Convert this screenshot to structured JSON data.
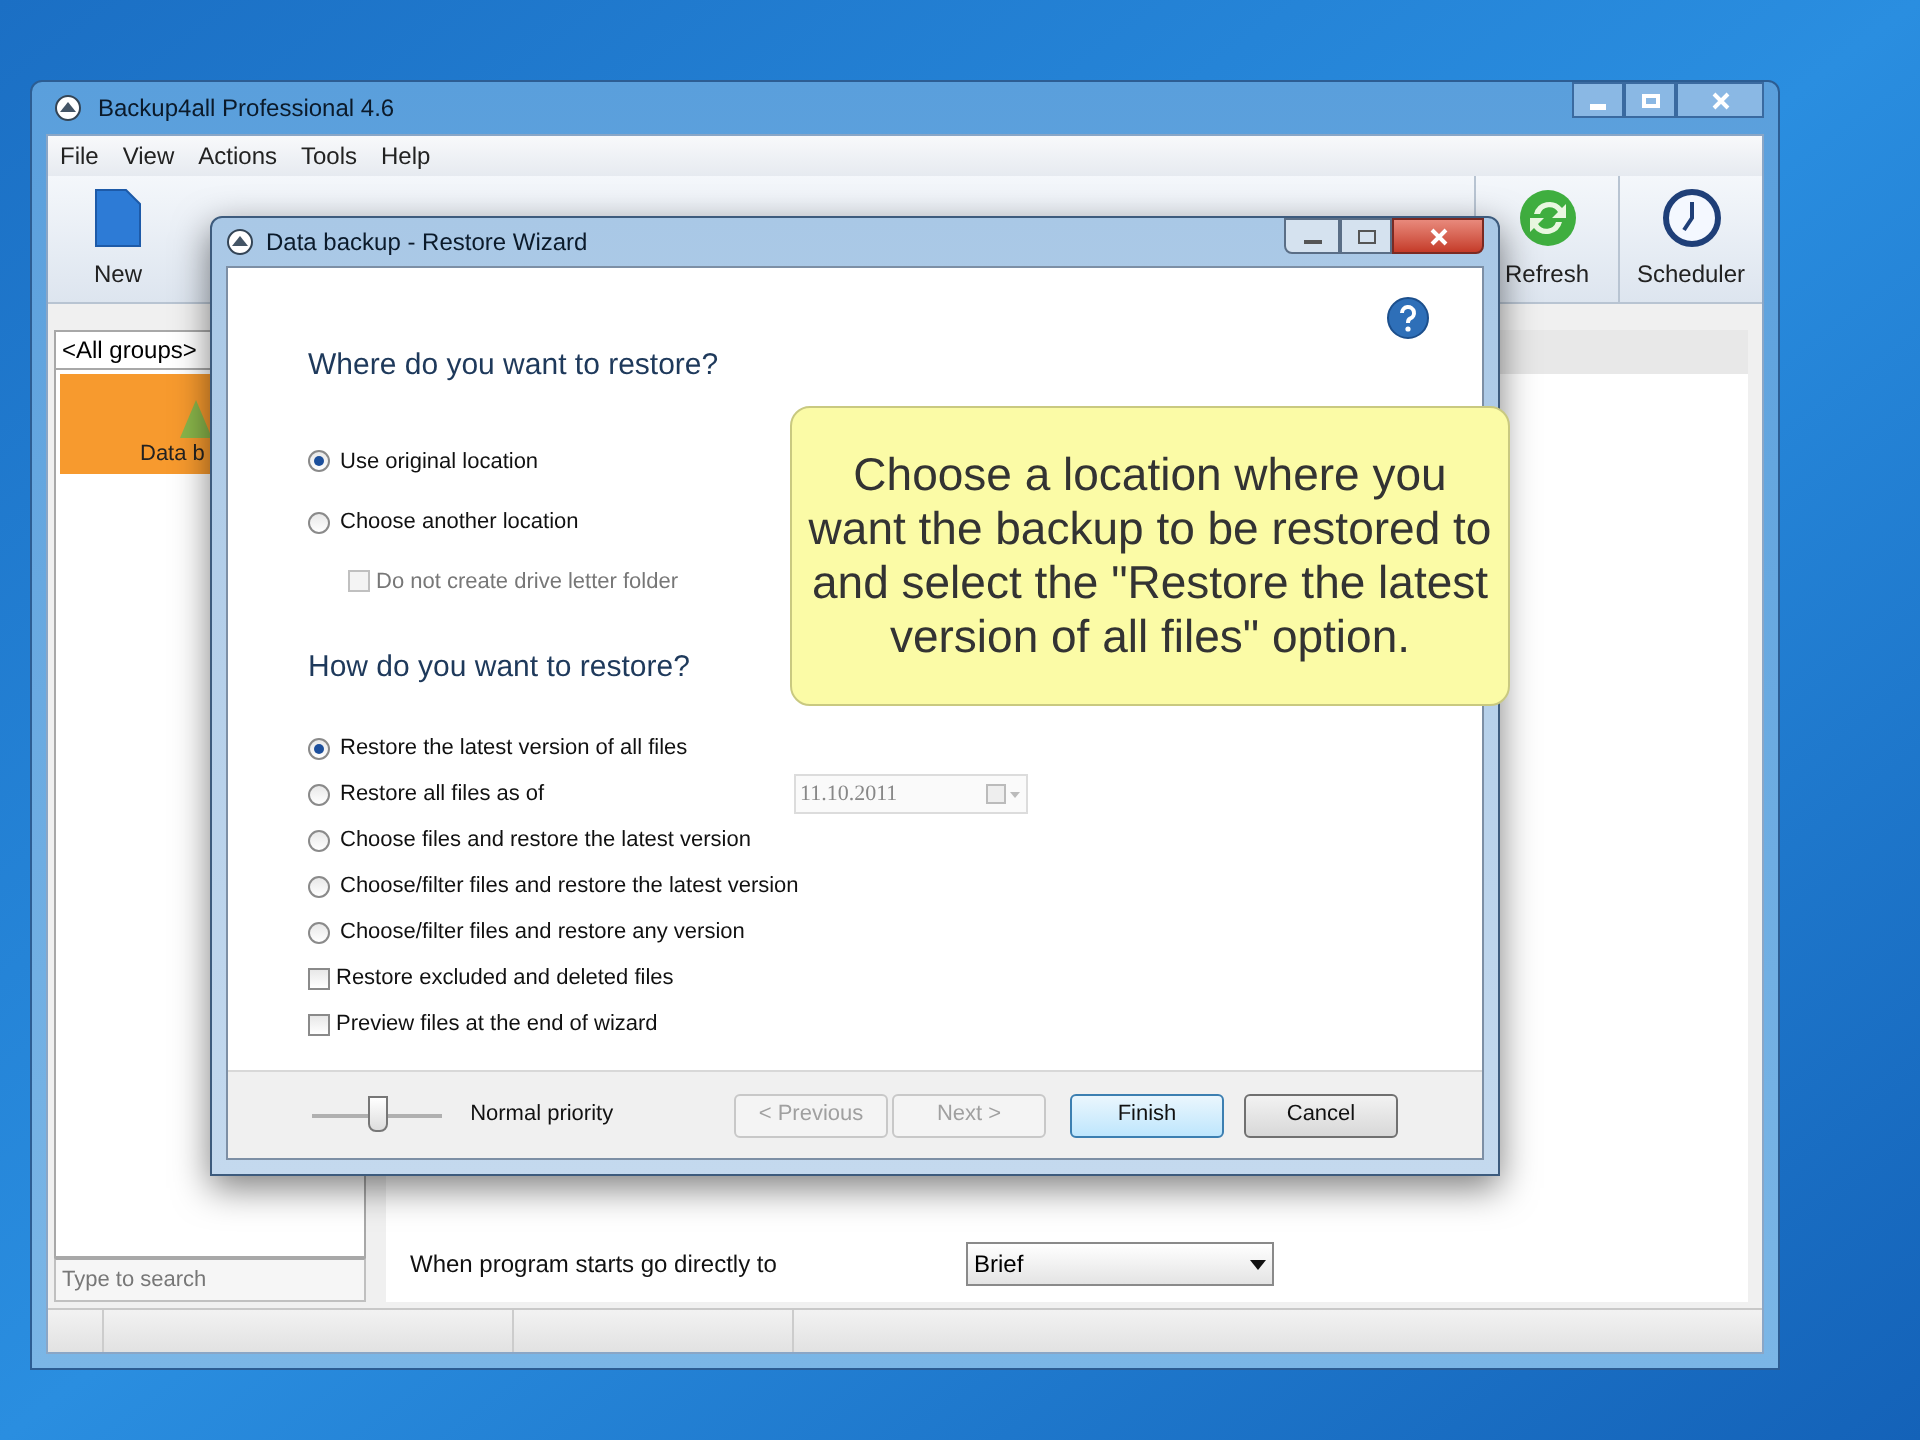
{
  "main_window": {
    "title": "Backup4all Professional 4.6",
    "menu": [
      "File",
      "View",
      "Actions",
      "Tools",
      "Help"
    ],
    "toolbar": [
      {
        "label": "New",
        "kind": "new"
      },
      {
        "label": "Refresh",
        "kind": "refresh"
      },
      {
        "label": "Scheduler",
        "kind": "scheduler"
      }
    ],
    "groups_dropdown": "<All groups>",
    "backup_tile": {
      "label": "Data b",
      "selected": true
    },
    "search": {
      "placeholder": "Type to search"
    },
    "startup_setting": {
      "label": "When program starts go directly to",
      "value": "Brief"
    }
  },
  "dialog": {
    "title": "Data backup - Restore Wizard",
    "where": {
      "heading": "Where do you want to restore?",
      "options": [
        {
          "label": "Use original location",
          "selected": true
        },
        {
          "label": "Choose another location",
          "selected": false
        }
      ],
      "drive_letter_checkbox": {
        "label": "Do not create drive letter folder",
        "checked": false,
        "disabled": true
      }
    },
    "how": {
      "heading": "How do you want to restore?",
      "options": [
        {
          "label": "Restore the latest version of all files",
          "selected": true
        },
        {
          "label": "Restore all files as of",
          "selected": false,
          "date": "11.10.2011"
        },
        {
          "label": "Choose files and restore the latest version",
          "selected": false
        },
        {
          "label": "Choose/filter files and restore the latest version",
          "selected": false
        },
        {
          "label": "Choose/filter files and restore any version",
          "selected": false
        }
      ],
      "checkboxes": [
        {
          "label": "Restore excluded and deleted files",
          "checked": false
        },
        {
          "label": "Preview files at the end of wizard",
          "checked": false
        }
      ]
    },
    "priority": {
      "level": 0.5,
      "label": "Normal priority"
    },
    "buttons": [
      {
        "label": "< Previous",
        "disabled": true,
        "default": false
      },
      {
        "label": "Next >",
        "disabled": true,
        "default": false
      },
      {
        "label": "Finish",
        "disabled": false,
        "default": true
      },
      {
        "label": "Cancel",
        "disabled": false,
        "default": false
      }
    ]
  },
  "tooltip": {
    "text": "Choose a location where you want the backup to be restored to and select the \"Restore the latest version of all files\" option."
  }
}
